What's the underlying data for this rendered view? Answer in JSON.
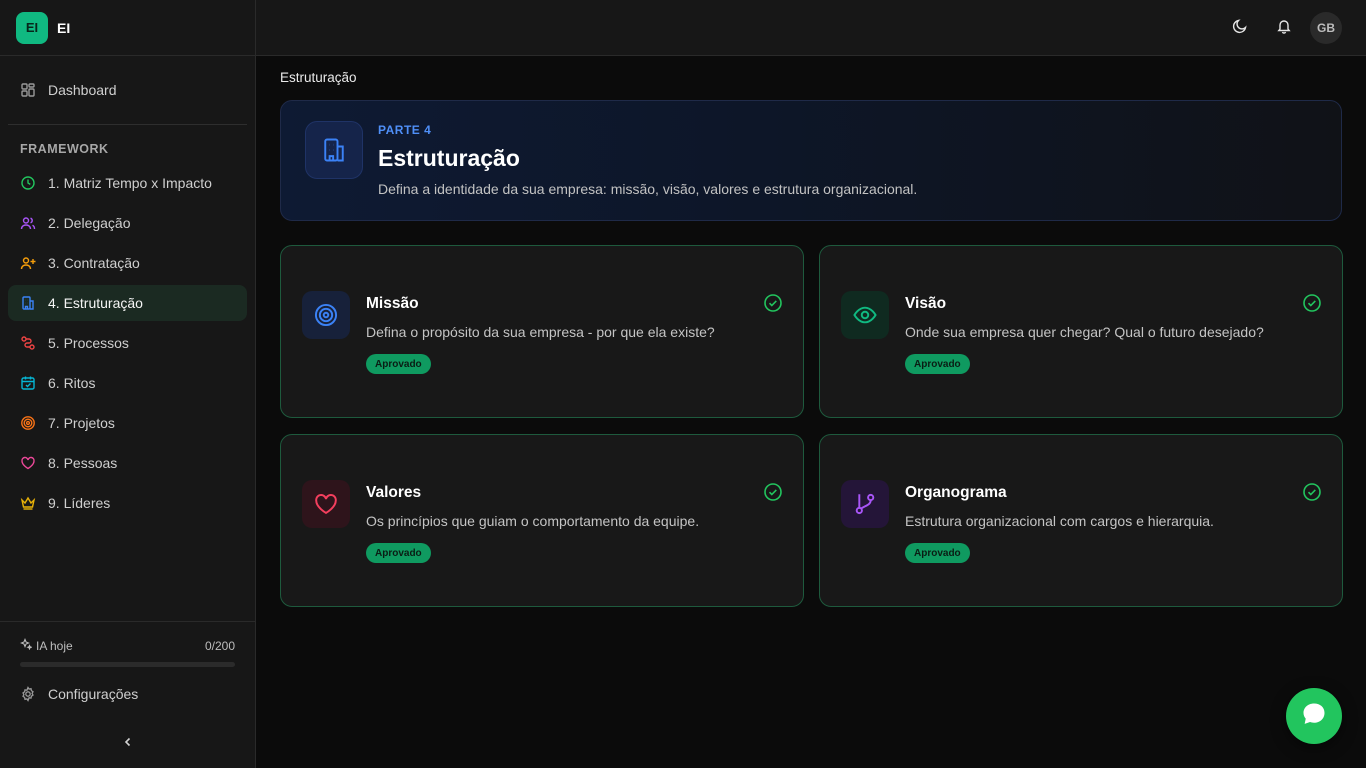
{
  "brand": {
    "logo_text": "EI",
    "name": "EI"
  },
  "sidebar": {
    "dashboard": {
      "label": "Dashboard",
      "icon": "layout-grid-icon"
    },
    "section_title": "FRAMEWORK",
    "items": [
      {
        "label": "1. Matriz Tempo x Impacto",
        "icon": "clock-icon",
        "color": "#22c55e"
      },
      {
        "label": "2. Delegação",
        "icon": "users-icon",
        "color": "#a855f7"
      },
      {
        "label": "3. Contratação",
        "icon": "user-plus-icon",
        "color": "#f59e0b"
      },
      {
        "label": "4. Estruturação",
        "icon": "building-icon",
        "color": "#3b82f6",
        "active": true
      },
      {
        "label": "5. Processos",
        "icon": "workflow-icon",
        "color": "#ef4444"
      },
      {
        "label": "6. Ritos",
        "icon": "calendar-check-icon",
        "color": "#06b6d4"
      },
      {
        "label": "7. Projetos",
        "icon": "target-icon",
        "color": "#f97316"
      },
      {
        "label": "8. Pessoas",
        "icon": "heart-icon",
        "color": "#ec4899"
      },
      {
        "label": "9. Líderes",
        "icon": "crown-icon",
        "color": "#eab308"
      }
    ],
    "ia": {
      "label": "IA hoje",
      "count": "0/200",
      "progress": 0
    },
    "settings_label": "Configurações"
  },
  "topbar": {
    "avatar_initials": "GB"
  },
  "breadcrumb": "Estruturação",
  "hero": {
    "kicker": "PARTE 4",
    "title": "Estruturação",
    "description": "Defina a identidade da sua empresa: missão, visão, valores e estrutura organizacional."
  },
  "cards": [
    {
      "title": "Missão",
      "description": "Defina o propósito da sua empresa - por que ela existe?",
      "status": "Aprovado",
      "icon": "target-icon",
      "color": "#3b82f6"
    },
    {
      "title": "Visão",
      "description": "Onde sua empresa quer chegar? Qual o futuro desejado?",
      "status": "Aprovado",
      "icon": "eye-icon",
      "color": "#10b981"
    },
    {
      "title": "Valores",
      "description": "Os princípios que guiam o comportamento da equipe.",
      "status": "Aprovado",
      "icon": "heart-icon",
      "color": "#f43f5e"
    },
    {
      "title": "Organograma",
      "description": "Estrutura organizacional com cargos e hierarquia.",
      "status": "Aprovado",
      "icon": "git-branch-icon",
      "color": "#a855f7"
    }
  ],
  "colors": {
    "accent": "#10b981",
    "card_border": "#1e5a3d",
    "badge": "#0f9a60"
  }
}
